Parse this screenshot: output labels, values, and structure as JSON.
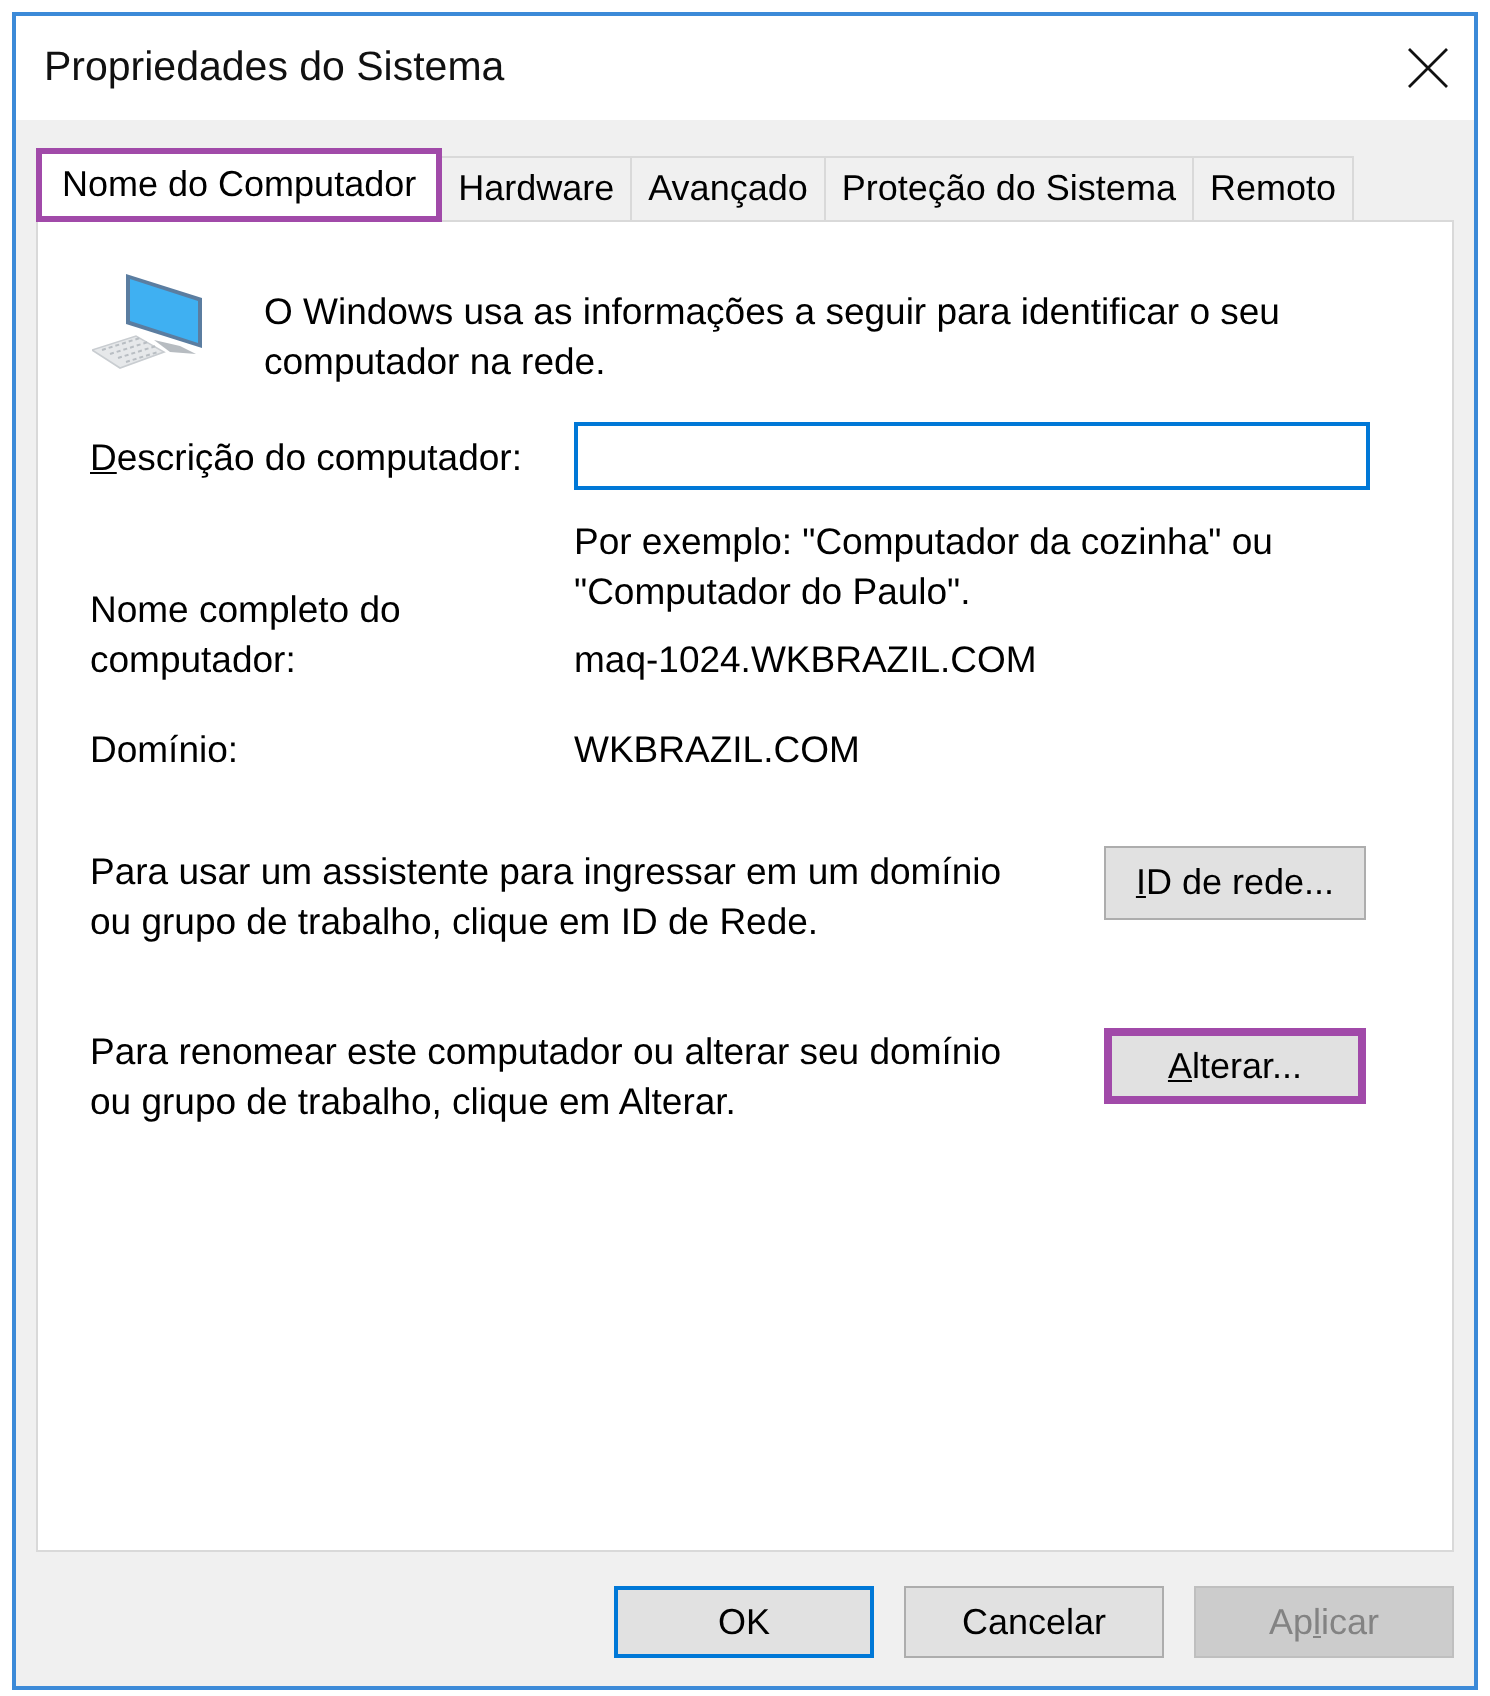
{
  "window": {
    "title": "Propriedades do Sistema"
  },
  "tabs": [
    {
      "label": "Nome do Computador",
      "selected": true,
      "highlighted": true
    },
    {
      "label": "Hardware",
      "selected": false,
      "highlighted": false
    },
    {
      "label": "Avançado",
      "selected": false,
      "highlighted": false
    },
    {
      "label": "Proteção do Sistema",
      "selected": false,
      "highlighted": false
    },
    {
      "label": "Remoto",
      "selected": false,
      "highlighted": false
    }
  ],
  "intro": "O Windows usa as informações a seguir para identificar o seu\ncomputador na rede.",
  "description_field": {
    "label": {
      "key": "D",
      "post": "escrição do computador:"
    },
    "focused": true
  },
  "example": "Por exemplo: \"Computador da cozinha\" ou\n\"Computador do Paulo\".",
  "info_rows": [
    {
      "label": "Nome completo do\ncomputador:",
      "value": "maq-1024.WKBRAZIL.COM"
    },
    {
      "label": "Domínio:",
      "value": "WKBRAZIL.COM"
    }
  ],
  "actions": [
    {
      "text": "Para usar um assistente para ingressar em um domínio\nou grupo de trabalho, clique em ID de Rede.",
      "button": {
        "label": {
          "key": "I",
          "post": "D de rede..."
        },
        "highlighted": false
      }
    },
    {
      "text": "Para renomear este computador ou alterar seu domínio\nou grupo de trabalho, clique em Alterar.",
      "button": {
        "label": {
          "key": "A",
          "post": "lterar..."
        },
        "highlighted": true
      }
    }
  ],
  "buttons": [
    {
      "label": {
        "pre": "OK"
      },
      "default": true,
      "disabled": false
    },
    {
      "label": {
        "pre": "Cancelar"
      },
      "default": false,
      "disabled": false
    },
    {
      "label": {
        "pre": "Ap",
        "key": "l",
        "post": "icar"
      },
      "default": false,
      "disabled": true
    }
  ]
}
